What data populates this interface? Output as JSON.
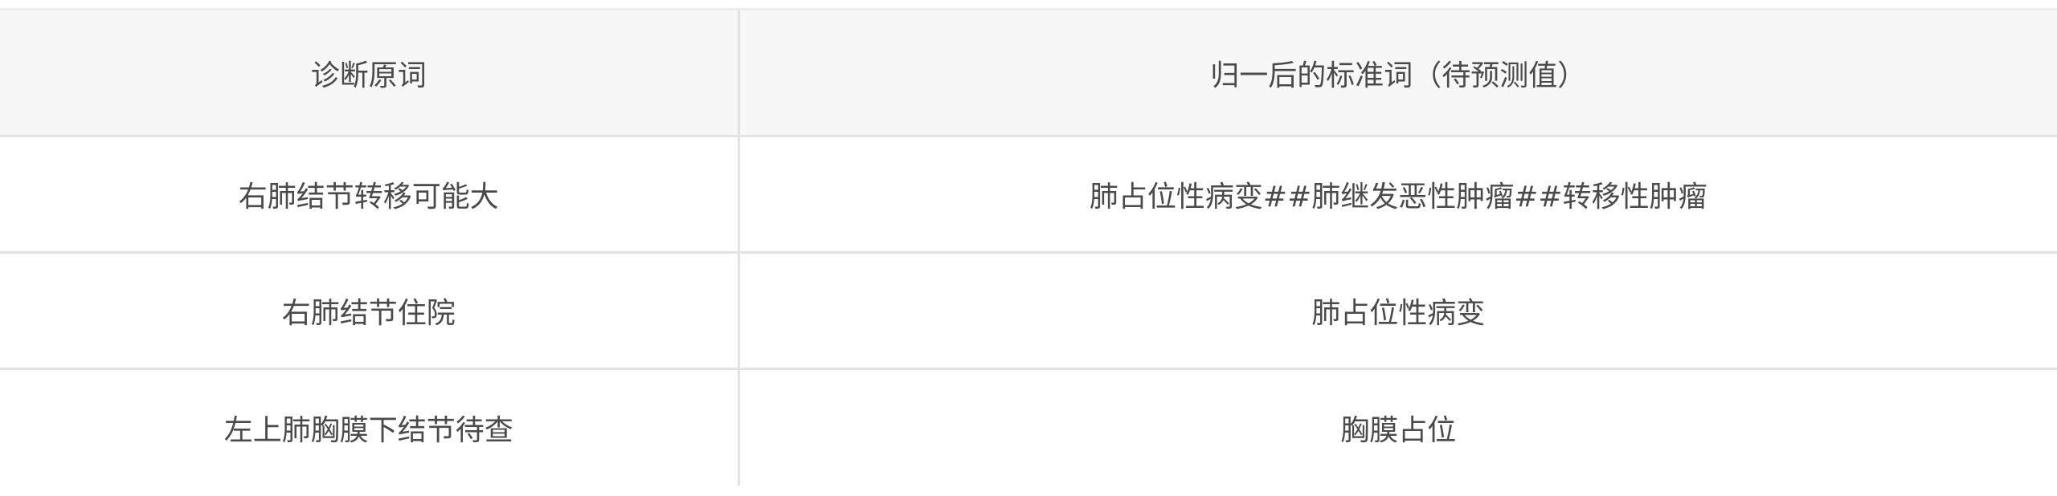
{
  "table": {
    "headers": [
      "诊断原词",
      "归一后的标准词（待预测值）"
    ],
    "rows": [
      [
        "右肺结节转移可能大",
        "肺占位性病变##肺继发恶性肿瘤##转移性肿瘤"
      ],
      [
        "右肺结节住院",
        "肺占位性病变"
      ],
      [
        "左上肺胸膜下结节待查",
        "胸膜占位"
      ]
    ]
  }
}
